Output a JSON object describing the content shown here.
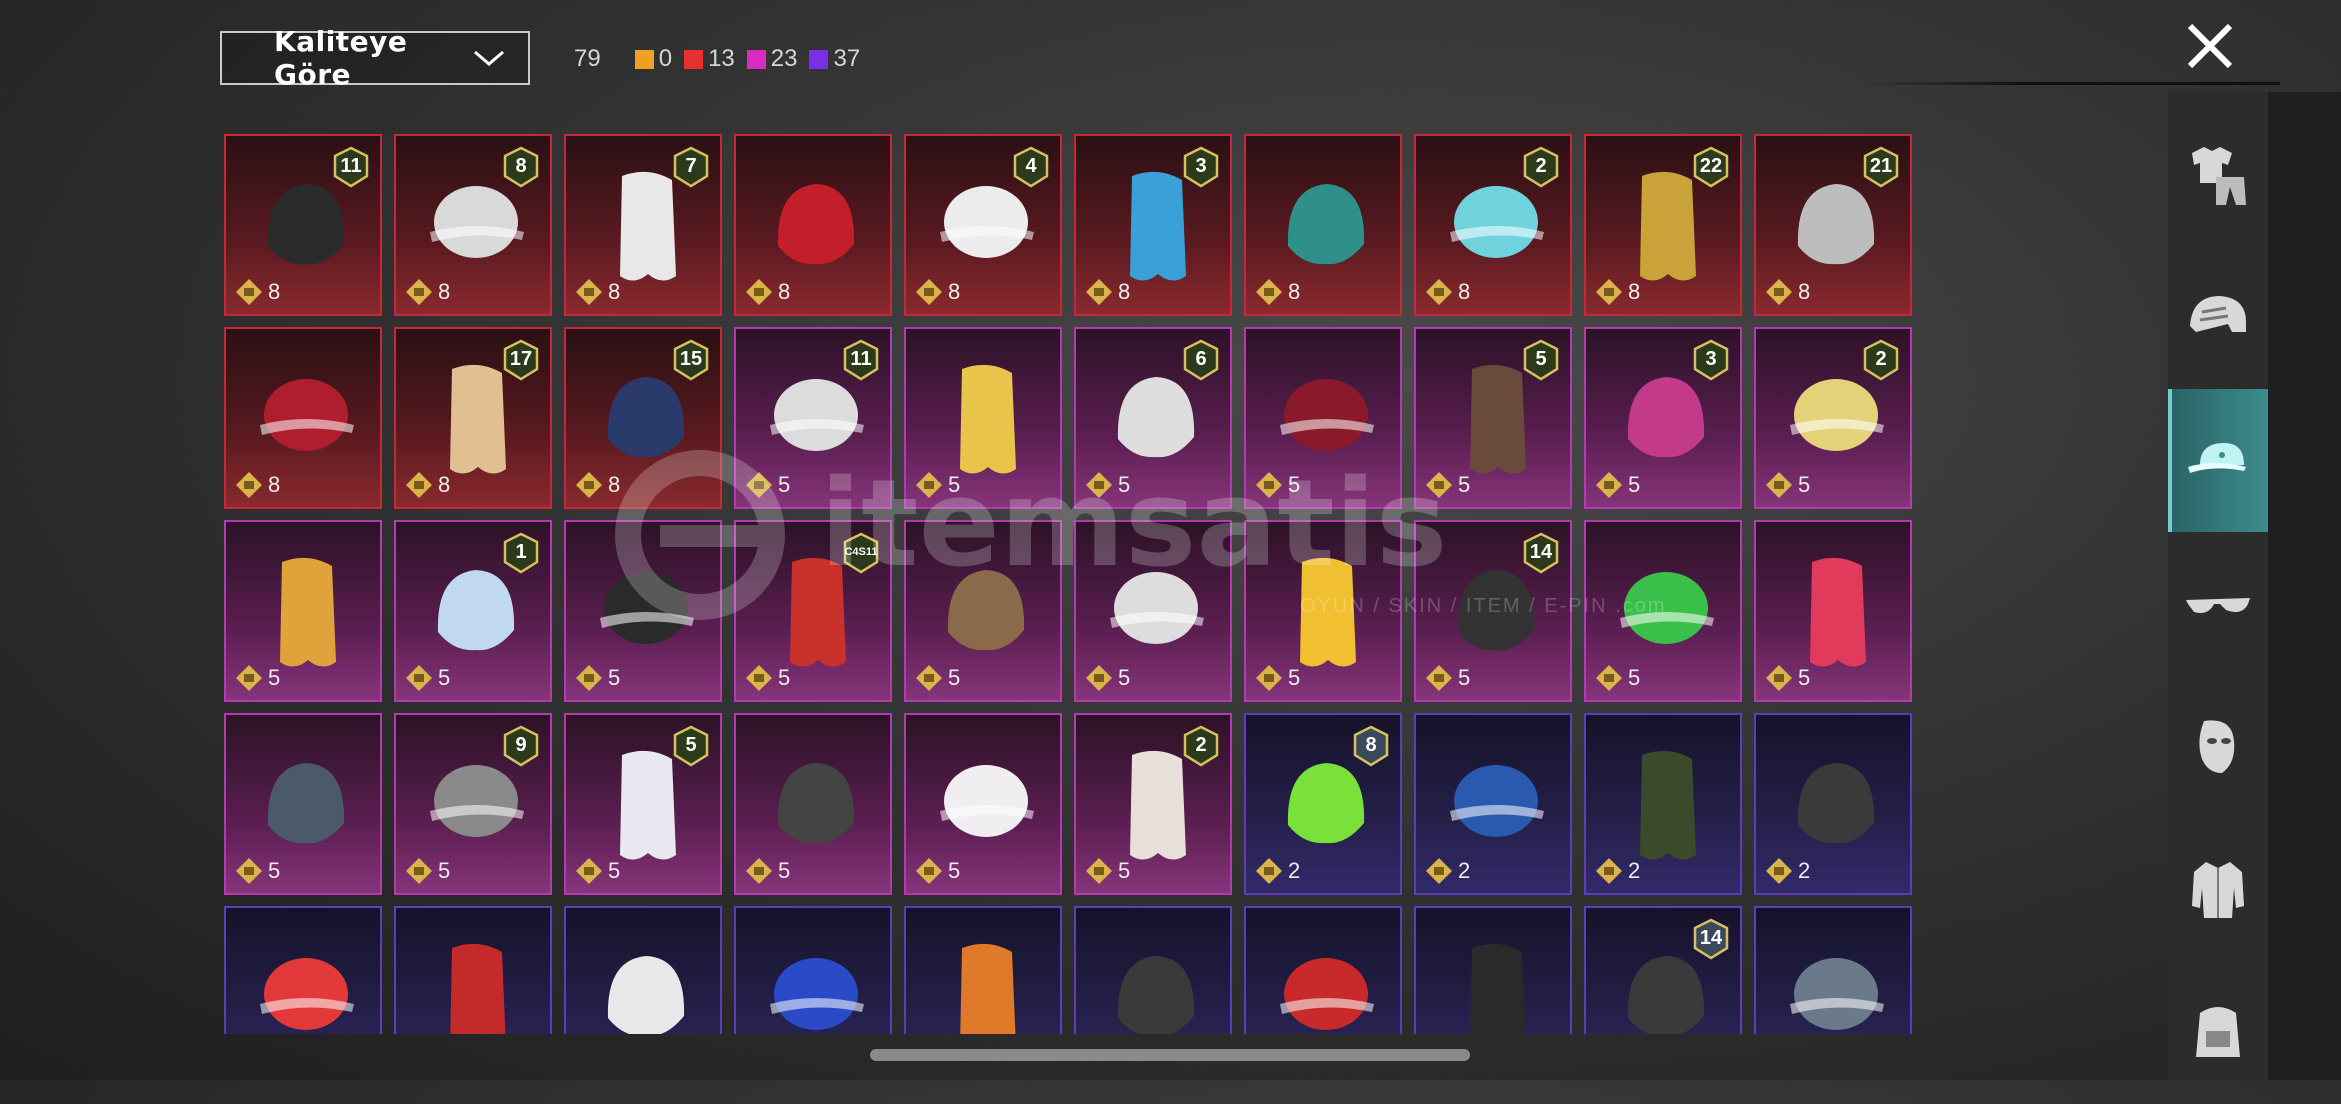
{
  "filter": {
    "sort_label": "Kaliteye Göre"
  },
  "counts": {
    "total": "79",
    "legendary": {
      "value": "0",
      "color": "#f0a020"
    },
    "red": {
      "value": "13",
      "color": "#e8312e"
    },
    "pink": {
      "value": "23",
      "color": "#d92bc0"
    },
    "purple": {
      "value": "37",
      "color": "#7a2ee8"
    }
  },
  "watermark": {
    "brand": "itemsatis",
    "tag": "OYUN / SKIN / ITEM / E-PIN .com"
  },
  "sidebar": {
    "tabs": [
      {
        "name": "outfit-tab",
        "icon": "outfit-icon"
      },
      {
        "name": "helmet-tab",
        "icon": "helmet-icon"
      },
      {
        "name": "hat-tab",
        "icon": "cap-icon",
        "active": true
      },
      {
        "name": "glasses-tab",
        "icon": "glasses-icon"
      },
      {
        "name": "mask-tab",
        "icon": "mask-icon"
      },
      {
        "name": "jacket-tab",
        "icon": "jacket-icon"
      },
      {
        "name": "backpack-tab",
        "icon": "backpack-icon"
      }
    ]
  },
  "items": [
    {
      "rarity": "red",
      "points": "8",
      "level": "11",
      "art": "dark-hair"
    },
    {
      "rarity": "red",
      "points": "8",
      "level": "8",
      "art": "white-hair-wings"
    },
    {
      "rarity": "red",
      "points": "8",
      "level": "7",
      "art": "white-long-hair"
    },
    {
      "rarity": "red",
      "points": "8",
      "level": "",
      "art": "red-helmet"
    },
    {
      "rarity": "red",
      "points": "8",
      "level": "4",
      "art": "snowman-top-hat"
    },
    {
      "rarity": "red",
      "points": "8",
      "level": "3",
      "art": "joker-blue-hair"
    },
    {
      "rarity": "red",
      "points": "8",
      "level": "",
      "art": "teal-dragon-helm"
    },
    {
      "rarity": "red",
      "points": "8",
      "level": "2",
      "art": "cyan-bucket-hair"
    },
    {
      "rarity": "red",
      "points": "8",
      "level": "22",
      "art": "golden-helm"
    },
    {
      "rarity": "red",
      "points": "8",
      "level": "21",
      "art": "clown-mask"
    },
    {
      "rarity": "red",
      "points": "8",
      "level": "",
      "art": "oni-helmet"
    },
    {
      "rarity": "red",
      "points": "8",
      "level": "17",
      "art": "white-gold-mask"
    },
    {
      "rarity": "red",
      "points": "8",
      "level": "15",
      "art": "blue-hooded-helm"
    },
    {
      "rarity": "pink",
      "points": "5",
      "level": "11",
      "art": "flower-crown-hair"
    },
    {
      "rarity": "pink",
      "points": "5",
      "level": "",
      "art": "blonde-ponytail"
    },
    {
      "rarity": "pink",
      "points": "5",
      "level": "6",
      "art": "black-white-visor"
    },
    {
      "rarity": "pink",
      "points": "5",
      "level": "",
      "art": "red-bow-hair"
    },
    {
      "rarity": "pink",
      "points": "5",
      "level": "5",
      "art": "cat-ear-hair"
    },
    {
      "rarity": "pink",
      "points": "5",
      "level": "3",
      "art": "jester-hat"
    },
    {
      "rarity": "pink",
      "points": "5",
      "level": "2",
      "art": "maid-headband"
    },
    {
      "rarity": "pink",
      "points": "5",
      "level": "",
      "art": "potato-head"
    },
    {
      "rarity": "pink",
      "points": "5",
      "level": "1",
      "art": "pastel-pigtails"
    },
    {
      "rarity": "pink",
      "points": "5",
      "level": "",
      "art": "dark-braids"
    },
    {
      "rarity": "pink",
      "points": "5",
      "level": "C4S11",
      "art": "red-cap"
    },
    {
      "rarity": "pink",
      "points": "5",
      "level": "",
      "art": "brown-twintails"
    },
    {
      "rarity": "pink",
      "points": "5",
      "level": "",
      "art": "gold-crown-hair"
    },
    {
      "rarity": "pink",
      "points": "5",
      "level": "",
      "art": "duck-mask"
    },
    {
      "rarity": "pink",
      "points": "5",
      "level": "14",
      "art": "officer-cap"
    },
    {
      "rarity": "pink",
      "points": "5",
      "level": "",
      "art": "frog-mask"
    },
    {
      "rarity": "pink",
      "points": "5",
      "level": "",
      "art": "red-beret-hair"
    },
    {
      "rarity": "pink",
      "points": "5",
      "level": "",
      "art": "gas-mask"
    },
    {
      "rarity": "pink",
      "points": "5",
      "level": "9",
      "art": "grey-dreads"
    },
    {
      "rarity": "pink",
      "points": "5",
      "level": "5",
      "art": "white-bowler-hat"
    },
    {
      "rarity": "pink",
      "points": "5",
      "level": "",
      "art": "small-ears"
    },
    {
      "rarity": "pink",
      "points": "5",
      "level": "",
      "art": "sun-hat"
    },
    {
      "rarity": "pink",
      "points": "5",
      "level": "2",
      "art": "bunny-mask"
    },
    {
      "rarity": "purple",
      "points": "2",
      "level": "8",
      "art": "green-skull-hood"
    },
    {
      "rarity": "purple",
      "points": "2",
      "level": "",
      "art": "white-cap"
    },
    {
      "rarity": "purple",
      "points": "2",
      "level": "",
      "art": "gas-helmet"
    },
    {
      "rarity": "purple",
      "points": "2",
      "level": "",
      "art": "tactical-helmet"
    },
    {
      "rarity": "purple",
      "points": "",
      "level": "",
      "art": "red-white-cap"
    },
    {
      "rarity": "purple",
      "points": "",
      "level": "",
      "art": "red-gold-cap"
    },
    {
      "rarity": "purple",
      "points": "",
      "level": "",
      "art": "football-helmet"
    },
    {
      "rarity": "purple",
      "points": "",
      "level": "",
      "art": "blue-cricket-helmet"
    },
    {
      "rarity": "purple",
      "points": "",
      "level": "",
      "art": "orange-visor-hair"
    },
    {
      "rarity": "purple",
      "points": "",
      "level": "",
      "art": "goggle-helmet"
    },
    {
      "rarity": "purple",
      "points": "",
      "level": "",
      "art": "striped-beanie"
    },
    {
      "rarity": "purple",
      "points": "",
      "level": "",
      "art": "moto-helmet"
    },
    {
      "rarity": "purple",
      "points": "",
      "level": "14",
      "art": "black-officer-cap"
    },
    {
      "rarity": "purple",
      "points": "",
      "level": "",
      "art": "goggles-beanie"
    }
  ]
}
